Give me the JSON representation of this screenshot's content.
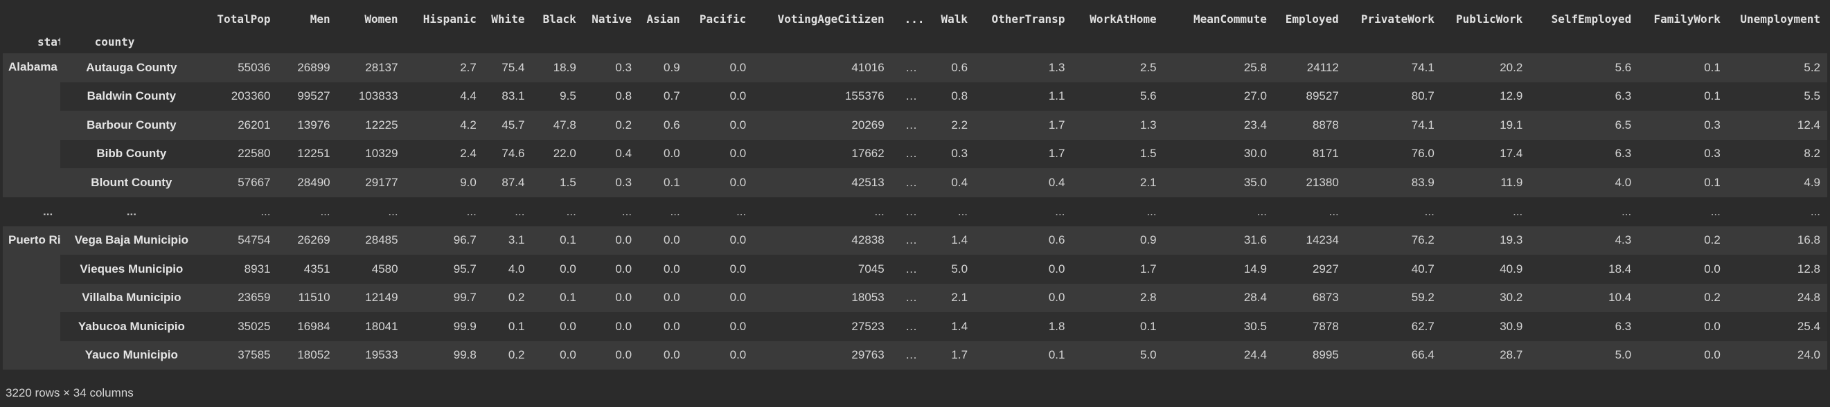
{
  "columns": [
    "TotalPop",
    "Men",
    "Women",
    "Hispanic",
    "White",
    "Black",
    "Native",
    "Asian",
    "Pacific",
    "VotingAgeCitizen",
    "...",
    "Walk",
    "OtherTransp",
    "WorkAtHome",
    "MeanCommute",
    "Employed",
    "PrivateWork",
    "PublicWork",
    "SelfEmployed",
    "FamilyWork",
    "Unemployment"
  ],
  "index_names": [
    "state",
    "county"
  ],
  "groups": [
    {
      "state": "Alabama",
      "rows": [
        {
          "county": "Autauga County",
          "values": [
            "55036",
            "26899",
            "28137",
            "2.7",
            "75.4",
            "18.9",
            "0.3",
            "0.9",
            "0.0",
            "41016",
            "...",
            "0.6",
            "1.3",
            "2.5",
            "25.8",
            "24112",
            "74.1",
            "20.2",
            "5.6",
            "0.1",
            "5.2"
          ]
        },
        {
          "county": "Baldwin County",
          "values": [
            "203360",
            "99527",
            "103833",
            "4.4",
            "83.1",
            "9.5",
            "0.8",
            "0.7",
            "0.0",
            "155376",
            "...",
            "0.8",
            "1.1",
            "5.6",
            "27.0",
            "89527",
            "80.7",
            "12.9",
            "6.3",
            "0.1",
            "5.5"
          ]
        },
        {
          "county": "Barbour County",
          "values": [
            "26201",
            "13976",
            "12225",
            "4.2",
            "45.7",
            "47.8",
            "0.2",
            "0.6",
            "0.0",
            "20269",
            "...",
            "2.2",
            "1.7",
            "1.3",
            "23.4",
            "8878",
            "74.1",
            "19.1",
            "6.5",
            "0.3",
            "12.4"
          ]
        },
        {
          "county": "Bibb County",
          "values": [
            "22580",
            "12251",
            "10329",
            "2.4",
            "74.6",
            "22.0",
            "0.4",
            "0.0",
            "0.0",
            "17662",
            "...",
            "0.3",
            "1.7",
            "1.5",
            "30.0",
            "8171",
            "76.0",
            "17.4",
            "6.3",
            "0.3",
            "8.2"
          ]
        },
        {
          "county": "Blount County",
          "values": [
            "57667",
            "28490",
            "29177",
            "9.0",
            "87.4",
            "1.5",
            "0.3",
            "0.1",
            "0.0",
            "42513",
            "...",
            "0.4",
            "0.4",
            "2.1",
            "35.0",
            "21380",
            "83.9",
            "11.9",
            "4.0",
            "0.1",
            "4.9"
          ]
        }
      ]
    },
    {
      "state": "Puerto Rico",
      "rows": [
        {
          "county": "Vega Baja Municipio",
          "values": [
            "54754",
            "26269",
            "28485",
            "96.7",
            "3.1",
            "0.1",
            "0.0",
            "0.0",
            "0.0",
            "42838",
            "...",
            "1.4",
            "0.6",
            "0.9",
            "31.6",
            "14234",
            "76.2",
            "19.3",
            "4.3",
            "0.2",
            "16.8"
          ]
        },
        {
          "county": "Vieques Municipio",
          "values": [
            "8931",
            "4351",
            "4580",
            "95.7",
            "4.0",
            "0.0",
            "0.0",
            "0.0",
            "0.0",
            "7045",
            "...",
            "5.0",
            "0.0",
            "1.7",
            "14.9",
            "2927",
            "40.7",
            "40.9",
            "18.4",
            "0.0",
            "12.8"
          ]
        },
        {
          "county": "Villalba Municipio",
          "values": [
            "23659",
            "11510",
            "12149",
            "99.7",
            "0.2",
            "0.1",
            "0.0",
            "0.0",
            "0.0",
            "18053",
            "...",
            "2.1",
            "0.0",
            "2.8",
            "28.4",
            "6873",
            "59.2",
            "30.2",
            "10.4",
            "0.2",
            "24.8"
          ]
        },
        {
          "county": "Yabucoa Municipio",
          "values": [
            "35025",
            "16984",
            "18041",
            "99.9",
            "0.1",
            "0.0",
            "0.0",
            "0.0",
            "0.0",
            "27523",
            "...",
            "1.4",
            "1.8",
            "0.1",
            "30.5",
            "7878",
            "62.7",
            "30.9",
            "6.3",
            "0.0",
            "25.4"
          ]
        },
        {
          "county": "Yauco Municipio",
          "values": [
            "37585",
            "18052",
            "19533",
            "99.8",
            "0.2",
            "0.0",
            "0.0",
            "0.0",
            "0.0",
            "29763",
            "...",
            "1.7",
            "0.1",
            "5.0",
            "24.4",
            "8995",
            "66.4",
            "28.7",
            "5.0",
            "0.0",
            "24.0"
          ]
        }
      ]
    }
  ],
  "ellipsis": "...",
  "middle_ellipsis": "…",
  "footer": "3220 rows × 34 columns"
}
